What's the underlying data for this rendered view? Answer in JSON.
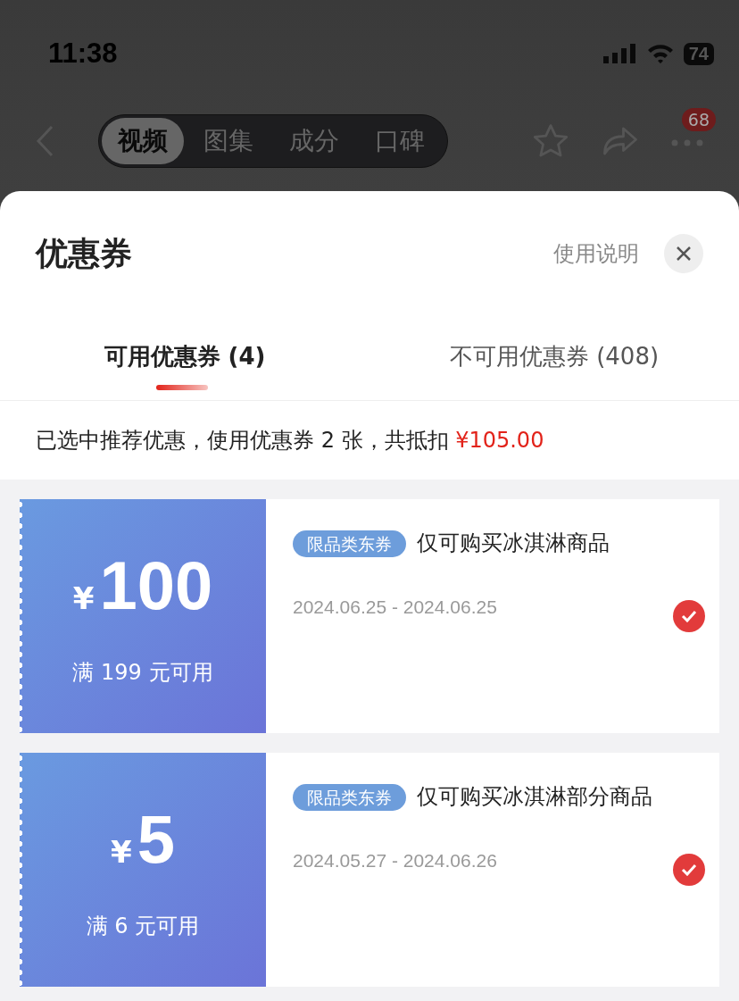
{
  "status_bar": {
    "time": "11:38",
    "battery": "74"
  },
  "nav": {
    "tabs": [
      {
        "label": "视频",
        "selected": true
      },
      {
        "label": "图集",
        "selected": false
      },
      {
        "label": "成分",
        "selected": false
      },
      {
        "label": "口碑",
        "selected": false
      }
    ],
    "more_badge": "68"
  },
  "sheet": {
    "title": "优惠券",
    "help_link": "使用说明",
    "tabs": [
      {
        "label": "可用优惠券 (4)",
        "selected": true
      },
      {
        "label": "不可用优惠券 (408)",
        "selected": false
      }
    ],
    "summary": {
      "text": "已选中推荐优惠，使用优惠券 2 张，共抵扣 ",
      "amount": "¥105.00"
    },
    "coupons": [
      {
        "currency": "¥",
        "amount": "100",
        "condition": "满 199 元可用",
        "tag": "限品类东券",
        "title": "仅可购买冰淇淋商品",
        "dates": "2024.06.25 - 2024.06.25",
        "checked": true
      },
      {
        "currency": "¥",
        "amount": "5",
        "condition": "满 6 元可用",
        "tag": "限品类东券",
        "title": "仅可购买冰淇淋部分商品",
        "dates": "2024.05.27 - 2024.06.26",
        "checked": true
      }
    ]
  }
}
